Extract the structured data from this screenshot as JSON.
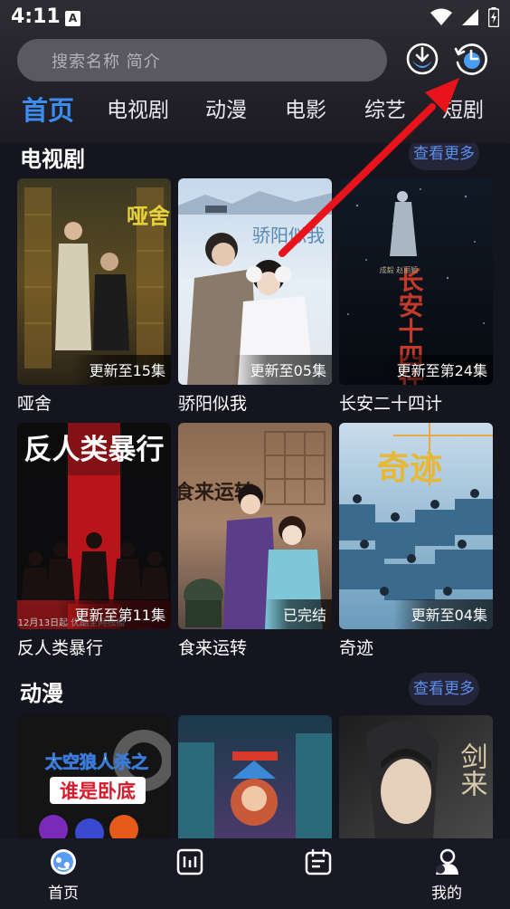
{
  "status_bar": {
    "time": "4:11",
    "notification_icon": "a-icon",
    "wifi_icon": "wifi-icon",
    "signal_icon": "signal-icon",
    "battery_icon": "battery-charging-icon"
  },
  "search": {
    "placeholder": "搜索名称 简介"
  },
  "header_icons": [
    "download-icon",
    "history-icon"
  ],
  "tabs": [
    {
      "label": "首页",
      "active": true
    },
    {
      "label": "电视剧",
      "active": false
    },
    {
      "label": "动漫",
      "active": false
    },
    {
      "label": "电影",
      "active": false
    },
    {
      "label": "综艺",
      "active": false
    },
    {
      "label": "短剧",
      "active": false
    }
  ],
  "sections": {
    "tv": {
      "title": "电视剧",
      "more_label": "查看更多",
      "items": [
        {
          "title": "哑舍",
          "badge": "更新至15集",
          "poster_text": "哑舍"
        },
        {
          "title": "骄阳似我",
          "badge": "更新至05集",
          "poster_text": "骄阳似我"
        },
        {
          "title": "长安二十四计",
          "badge": "更新至第24集",
          "poster_text": "长安十四计"
        },
        {
          "title": "反人类暴行",
          "badge": "更新至第11集",
          "poster_text": "反人类暴行",
          "poster_caption": "12月13日起 优酷全网独播"
        },
        {
          "title": "食来运转",
          "badge": "已完结",
          "poster_text": "食来运转"
        },
        {
          "title": "奇迹",
          "badge": "更新至04集",
          "poster_text": "奇迹"
        }
      ]
    },
    "anime": {
      "title": "动漫",
      "more_label": "查看更多",
      "items": [
        {
          "poster_text_1": "太空狼人杀之",
          "poster_text_2": "谁是卧底"
        },
        {
          "poster_text_1": ""
        },
        {
          "poster_text_1": "剑来"
        }
      ]
    }
  },
  "bottom_nav": [
    {
      "label": "首页",
      "icon": "home-icon",
      "active": true
    },
    {
      "label": "",
      "icon": "charts-icon",
      "active": false
    },
    {
      "label": "",
      "icon": "schedule-icon",
      "active": false
    },
    {
      "label": "我的",
      "icon": "profile-icon",
      "active": false
    }
  ],
  "colors": {
    "accent": "#3d8cf0",
    "background": "#15151f",
    "annotation_arrow": "#e8131b"
  }
}
